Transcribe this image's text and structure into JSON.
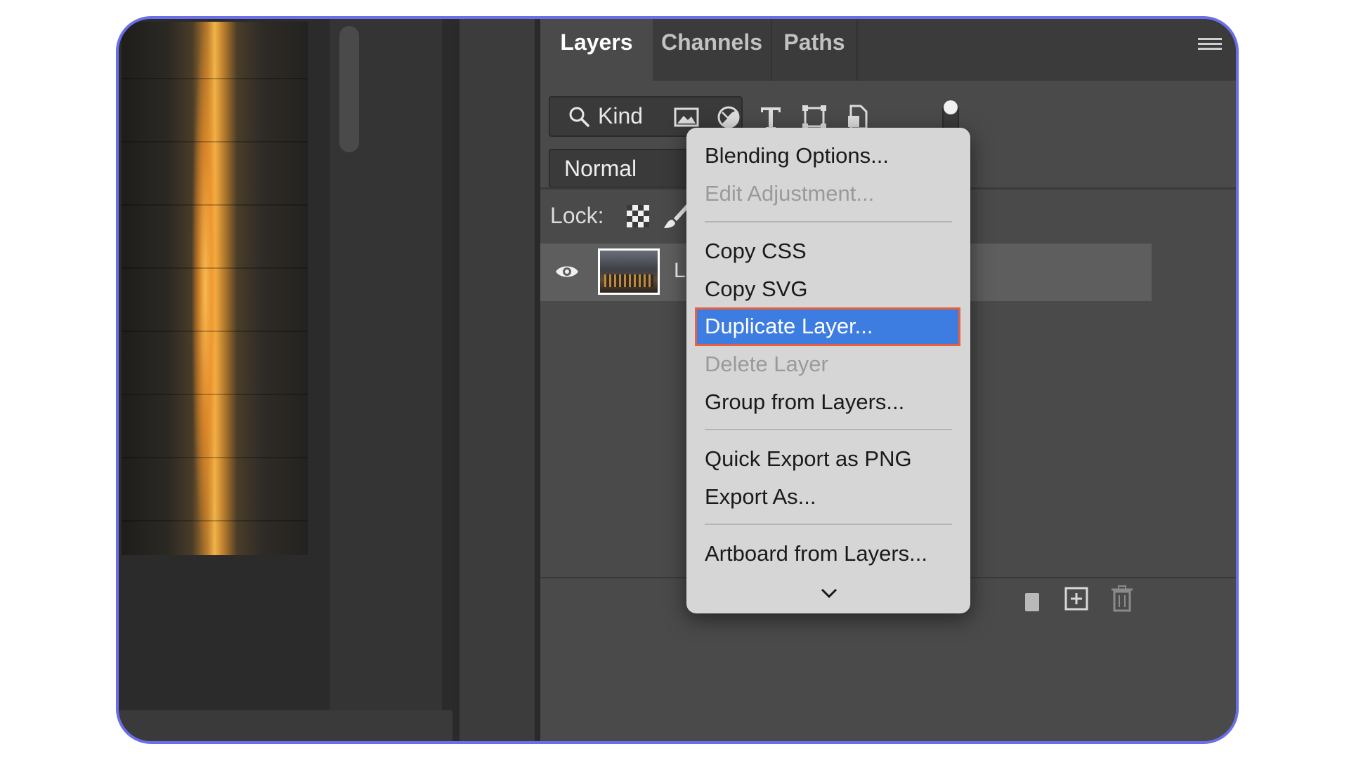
{
  "panel": {
    "tabs": [
      {
        "label": "Layers",
        "active": true
      },
      {
        "label": "Channels"
      },
      {
        "label": "Paths"
      }
    ],
    "menu_icon": "hamburger-menu-icon"
  },
  "filter": {
    "kind_label": "Kind",
    "icons": [
      "image-filter-icon",
      "adjustment-filter-icon",
      "type-filter-icon",
      "shape-filter-icon",
      "smart-object-filter-icon",
      "filter-toggle-icon"
    ]
  },
  "blend": {
    "mode": "Normal"
  },
  "lock": {
    "label": "Lock:",
    "icons": [
      "lock-transparent-pixels-icon",
      "lock-image-pixels-icon",
      "lock-position-icon",
      "lock-artboard-icon"
    ]
  },
  "layers": [
    {
      "name": "Layer 0",
      "visible": true
    }
  ],
  "context_menu": {
    "items": [
      {
        "label": "Blending Options...",
        "enabled": true
      },
      {
        "label": "Edit Adjustment...",
        "enabled": false
      },
      {
        "label": "Copy CSS",
        "enabled": true
      },
      {
        "label": "Copy SVG",
        "enabled": true
      },
      {
        "label": "Duplicate Layer...",
        "enabled": true,
        "highlighted": true
      },
      {
        "label": "Delete Layer",
        "enabled": false
      },
      {
        "label": "Group from Layers...",
        "enabled": true
      },
      {
        "label": "Quick Export as PNG",
        "enabled": true
      },
      {
        "label": "Export As...",
        "enabled": true
      },
      {
        "label": "Artboard from Layers...",
        "enabled": true
      }
    ],
    "more_icon": "chevron-down-icon"
  },
  "colors": {
    "highlight": "#3d7ce0",
    "highlight_border": "#e8603c",
    "frame_border": "#6a6ee8"
  }
}
